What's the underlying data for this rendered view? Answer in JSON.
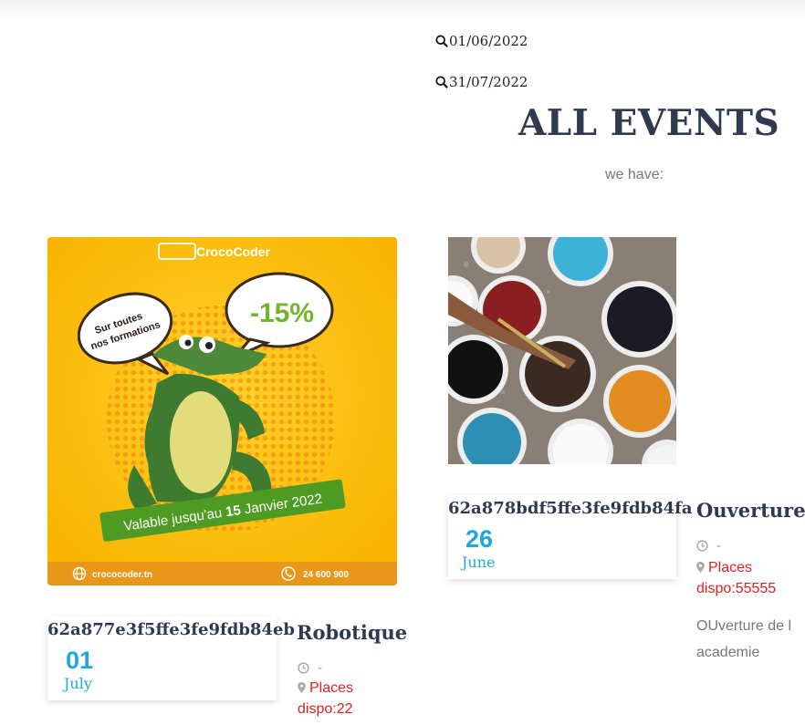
{
  "filters": {
    "start_date": "01/06/2022",
    "end_date": "31/07/2022"
  },
  "page": {
    "title": "ALL EVENTS",
    "subtitle": "we have:"
  },
  "events": [
    {
      "id": "62a877e3f5ffe3fe9fdb84eb",
      "day": "01",
      "month": "July",
      "title": "Robotique",
      "time": "-",
      "places": "Places dispo:22",
      "image": {
        "brand": "CrocoCoder",
        "discount": "-15%",
        "bubble_line1": "Sur toutes",
        "bubble_line2": "nos formations",
        "banner_prefix": "Valable jusqu'au ",
        "banner_bold": "15",
        "banner_suffix": " Janvier 2022",
        "website": "crococoder.tn",
        "phone": "24 600 900"
      }
    },
    {
      "id": "62a878bdf5ffe3fe9fdb84fa",
      "day": "26",
      "month": "June",
      "title": "Ouverture",
      "time": "-",
      "places_line1": "Places",
      "places_line2": "dispo:55555",
      "description": "OUverture de l academie"
    }
  ],
  "colors": {
    "accent": "#1fa8e0",
    "heading": "#2e3a4f",
    "places": "#e02020",
    "muted": "#777777"
  },
  "icons": [
    "search-icon",
    "clock-icon",
    "map-marker-icon",
    "globe-icon",
    "phone-icon"
  ]
}
